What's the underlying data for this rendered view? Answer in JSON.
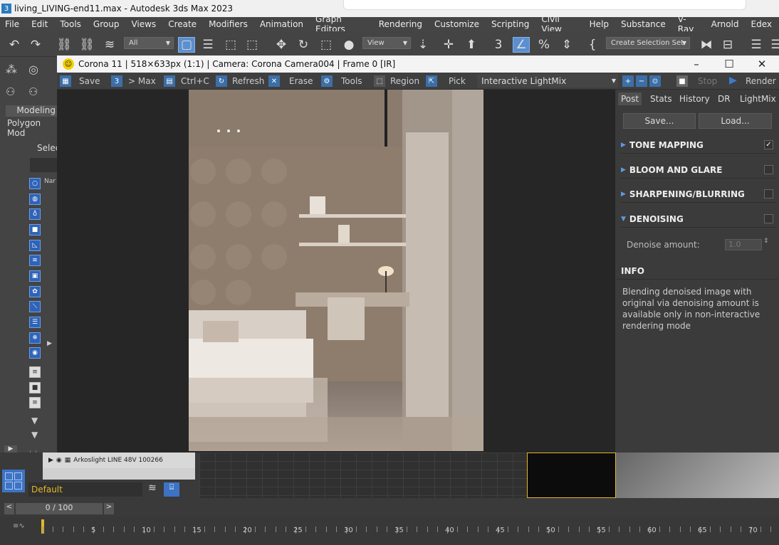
{
  "window": {
    "title": "living_LIVING-end11.max - Autodesk 3ds Max 2023"
  },
  "menu": [
    "File",
    "Edit",
    "Tools",
    "Group",
    "Views",
    "Create",
    "Modifiers",
    "Animation",
    "Graph Editors",
    "Rendering",
    "Customize",
    "Scripting",
    "Civil View",
    "Help",
    "Substance",
    "V-Ray",
    "Arnold",
    "Edex"
  ],
  "toolbar": {
    "filter_value": "All",
    "refcoord_value": "View",
    "selection_set": "Create Selection Set"
  },
  "left": {
    "ribbon_tab": "Modeling",
    "ribbon_sub": "Polygon Mod",
    "select_label": "Selec",
    "name_header": "Nar"
  },
  "corona": {
    "title": "Corona 11 | 518×633px (1:1) | Camera: Corona Camera004 | Frame 0 [IR]",
    "buttons": {
      "save": "Save",
      "to_max": "> Max",
      "copy": "Ctrl+C",
      "refresh": "Refresh",
      "erase": "Erase",
      "tools": "Tools",
      "region": "Region",
      "pick": "Pick",
      "stop": "Stop",
      "render": "Render"
    },
    "lightmix_select": "Interactive LightMix",
    "tabs": [
      "Post",
      "Stats",
      "History",
      "DR",
      "LightMix"
    ],
    "panel": {
      "save": "Save...",
      "load": "Load..."
    },
    "sections": {
      "tone": "TONE MAPPING",
      "bloom": "BLOOM AND GLARE",
      "sharpen": "SHARPENING/BLURRING",
      "denoise": "DENOISING",
      "denoise_label": "Denoise amount:",
      "denoise_value": "1.0",
      "info_title": "INFO",
      "info_text": "Blending denoised image with original via denoising amount is available only in non-interactive rendering mode"
    }
  },
  "bottom": {
    "layer_item": "Arkoslight LINE 48V 100266",
    "workspace": "Default",
    "frame_counter": "0 / 100",
    "timeline_numbers": [
      "5",
      "10",
      "15",
      "20",
      "25",
      "30",
      "35",
      "40",
      "45",
      "50",
      "55",
      "60",
      "65",
      "70"
    ]
  },
  "colors": {
    "accent_blue": "#2e63b8",
    "panel_dark": "#3b3b3b",
    "highlight_yellow": "#e2b72a"
  }
}
